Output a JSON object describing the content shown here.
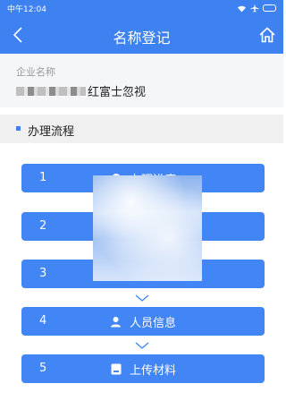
{
  "status_bar": {
    "time": "中午12:04"
  },
  "nav": {
    "title": "名称登记",
    "back_icon": "chevron-left-icon",
    "home_icon": "home-icon"
  },
  "company": {
    "label": "企业名称",
    "name_visible": "红富士忽视"
  },
  "section": {
    "title": "办理流程"
  },
  "steps": [
    {
      "number": "1",
      "label": "办理进度",
      "icon": "progress-icon"
    },
    {
      "number": "2",
      "label": "",
      "icon": "document-icon"
    },
    {
      "number": "3",
      "label": "",
      "icon": "document-icon"
    },
    {
      "number": "4",
      "label": "人员信息",
      "icon": "person-icon"
    },
    {
      "number": "5",
      "label": "上传材料",
      "icon": "upload-icon"
    }
  ],
  "colors": {
    "primary": "#3d82f0",
    "button": "#4285f4",
    "section_bg": "#f0f0f0",
    "company_bg": "#f5f6f8"
  }
}
